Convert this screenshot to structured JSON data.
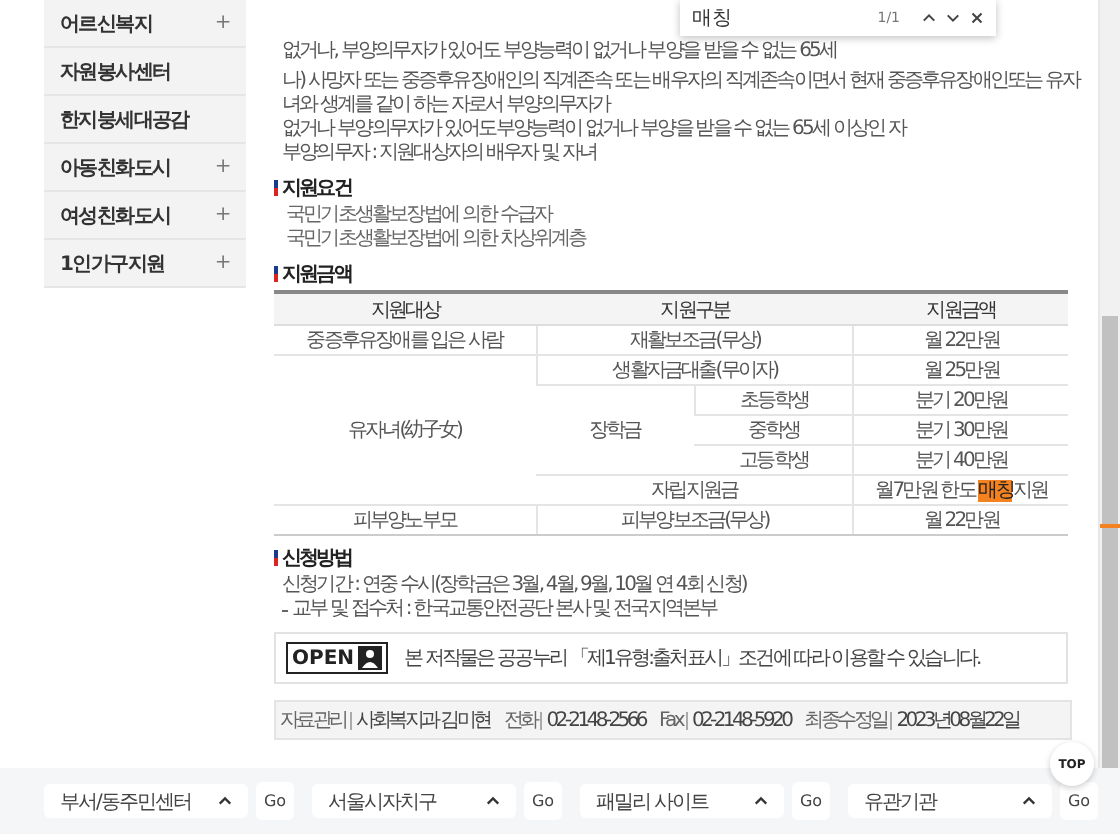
{
  "sidebar": {
    "items": [
      {
        "label": "어르신복지",
        "expandable": true
      },
      {
        "label": "자원봉사센터",
        "expandable": false
      },
      {
        "label": "한지붕세대공감",
        "expandable": false
      },
      {
        "label": "아동친화도시",
        "expandable": true
      },
      {
        "label": "여성친화도시",
        "expandable": true
      },
      {
        "label": "1인가구지원",
        "expandable": true
      }
    ],
    "expand_glyph": "+"
  },
  "intro": [
    "없거나, 부양의무자가 있어도 부양능력이 없거나 부양을 받을 수 없는 65세",
    "나) 사망자 또는 중증후유장애인의 직계존속 또는 배우자의 직계존속이면서 현재 중증후유장애인또는 유자녀와 생계를 같이 하는 자로서 부양의무자가",
    "없거나 부양의무자가 있어도부양능력이 없거나 부양을 받을 수 없는 65세 이상인 자",
    "부양의무자 : 지원대상자의 배우자 및 자녀"
  ],
  "requirements": {
    "title": "지원요건",
    "items": [
      "국민기초생활보장법에 의한 수급자",
      "국민기초생활보장법에 의한 차상위계층"
    ]
  },
  "amounts": {
    "title": "지원금액",
    "columns": [
      "지원대상",
      "지원구분",
      "지원금액"
    ],
    "groups": [
      {
        "target": "중증후유장애를 입은 사람",
        "rows": [
          {
            "type": "재활보조금(무상)",
            "amount": {
              "before": "월 22만원"
            }
          }
        ]
      },
      {
        "target": "유자녀(幼子女)",
        "rows": [
          {
            "type": "생활자금대출(무이자)",
            "amount": {
              "before": "월 25만원"
            }
          },
          {
            "type": "장학금",
            "subs": [
              {
                "level": "초등학생",
                "amount": {
                  "before": "분기 20만원"
                }
              },
              {
                "level": "중학생",
                "amount": {
                  "before": "분기 30만원"
                }
              },
              {
                "level": "고등학생",
                "amount": {
                  "before": "분기 40만원"
                }
              }
            ]
          },
          {
            "type": "자립지원금",
            "amount": {
              "before": "월7만원 한도 ",
              "match": "매칭",
              "after": "지원"
            }
          }
        ]
      },
      {
        "target": "피부양노부모",
        "rows": [
          {
            "type": "피부양보조금(무상)",
            "amount": {
              "before": "월 22만원"
            }
          }
        ]
      }
    ]
  },
  "application": {
    "title": "신청방법",
    "lines": [
      {
        "bullet": false,
        "text": "신청기간 : 연중 수시(장학금은 3월, 4월, 9월, 10월 연 4회 신청)"
      },
      {
        "bullet": true,
        "text": "교부 및 접수처 : 한국교통안전공단 본사 및 전국지역본부"
      }
    ]
  },
  "license": {
    "logo": "OPEN",
    "text": "본 저작물은 공공누리 「제1유형:출처표시」조건에 따라 이용할 수 있습니다."
  },
  "info": [
    {
      "label": "자료관리",
      "value": "사회복지과 김미현"
    },
    {
      "label": "전화",
      "value": "02-2148-2566"
    },
    {
      "label": "Fax",
      "value": "02-2148-5920"
    },
    {
      "label": "최종수정일",
      "value": "2023년08월22일"
    }
  ],
  "find_bar": {
    "query": "매칭",
    "count": "1/1"
  },
  "footer_selects": [
    {
      "label": "부서/동주민센터",
      "button": "Go"
    },
    {
      "label": "서울시자치구",
      "button": "Go"
    },
    {
      "label": "패밀리 사이트",
      "button": "Go"
    },
    {
      "label": "유관기관",
      "button": "Go"
    }
  ],
  "top_button": "TOP"
}
